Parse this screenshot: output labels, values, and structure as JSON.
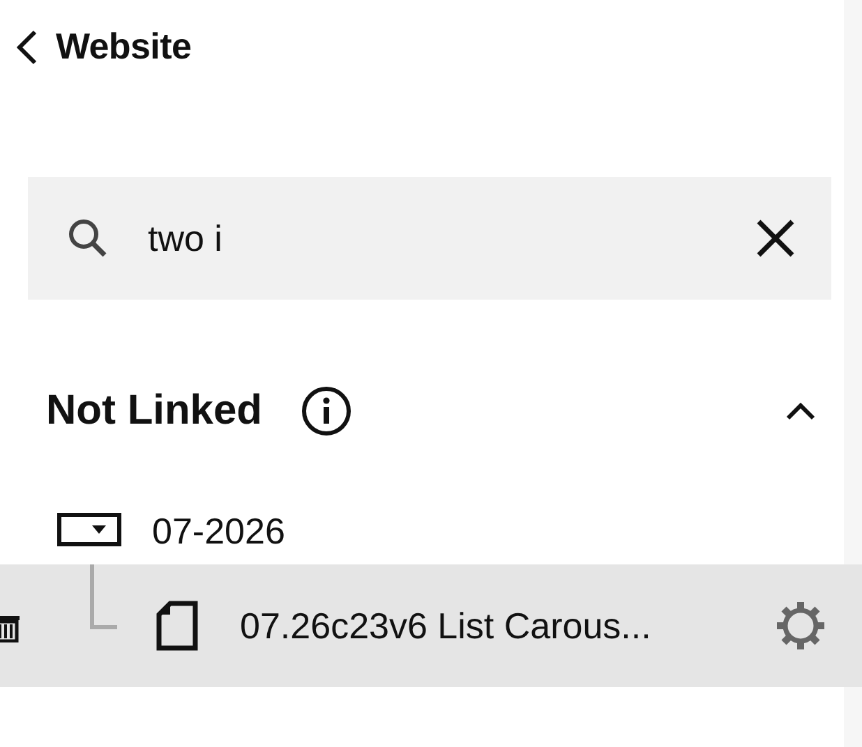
{
  "header": {
    "back_label": "Website"
  },
  "search": {
    "value": "two i"
  },
  "section": {
    "title": "Not Linked",
    "expanded": true,
    "folders": [
      {
        "name": "07-2026",
        "expanded": true,
        "children": [
          {
            "title": "07.26c23v6 List Carous...",
            "selected": true
          }
        ]
      }
    ]
  }
}
